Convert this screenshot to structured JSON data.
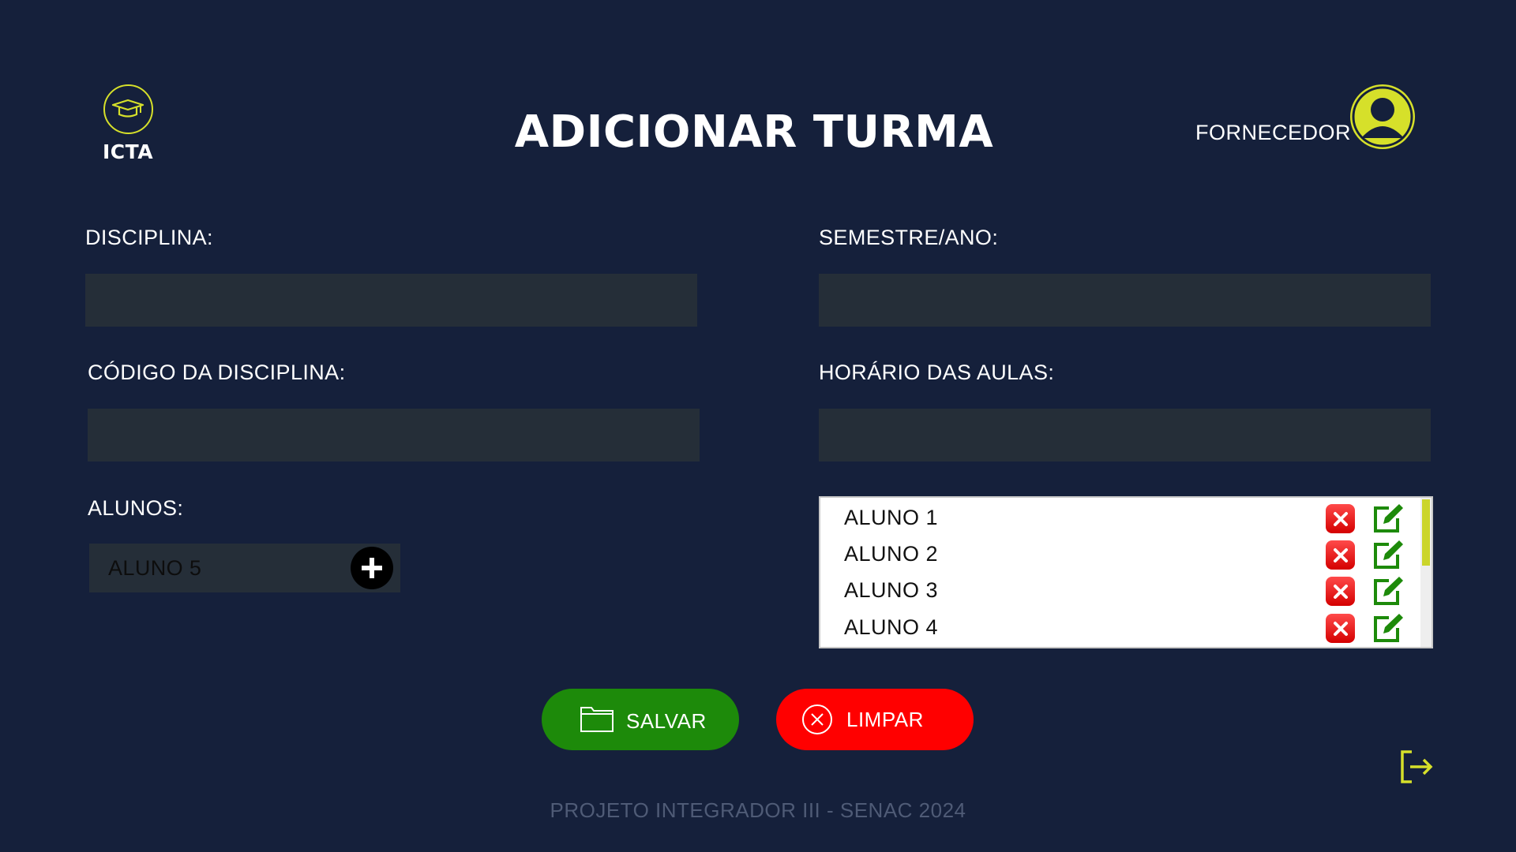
{
  "brand": {
    "name": "ICTA",
    "icon": "graduation-cap-icon",
    "accent": "#d6e02a"
  },
  "header": {
    "title": "ADICIONAR TURMA",
    "user_label": "FORNECEDOR",
    "avatar_icon": "user-avatar-icon"
  },
  "form": {
    "disciplina": {
      "label": "DISCIPLINA:",
      "value": ""
    },
    "semestre": {
      "label": "SEMESTRE/ANO:",
      "value": ""
    },
    "codigo": {
      "label": "CÓDIGO DA DISCIPLINA:",
      "value": ""
    },
    "horario": {
      "label": "HORÁRIO DAS AULAS:",
      "value": ""
    },
    "alunos": {
      "label": "ALUNOS:",
      "input_value": "ALUNO 5",
      "add_icon": "plus-icon"
    }
  },
  "students": [
    {
      "name": "ALUNO 1"
    },
    {
      "name": "ALUNO 2"
    },
    {
      "name": "ALUNO 3"
    },
    {
      "name": "ALUNO 4"
    }
  ],
  "actions": {
    "save": {
      "label": "SALVAR",
      "icon": "folder-icon",
      "color": "#1d8a0a"
    },
    "clear": {
      "label": "LIMPAR",
      "icon": "close-circle-icon",
      "color": "#ff0000"
    },
    "logout_icon": "logout-icon"
  },
  "footer": {
    "text": "PROJETO INTEGRADOR III - SENAC 2024"
  }
}
